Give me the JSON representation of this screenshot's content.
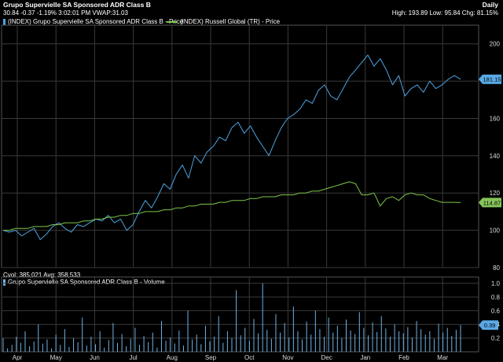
{
  "header": {
    "title": "Grupo Supervielle SA Sponsored ADR Class B",
    "quote_line": "30.84 -0.37 -1.19% 3:02:01 PM VWAP:31.03",
    "period": "Daily",
    "range_line": "High: 193.89 Low: 95.84 Chg: 81.15%"
  },
  "legend": {
    "series1": "(INDEX) Grupo Supervielle SA Sponsored ADR Class B - Price",
    "series2": "(INDEX) Russell Global (TR) - Price"
  },
  "volume_header": {
    "line1": "Cvol: 385,021 Avg: 358,533",
    "legend": "Grupo Supervielle SA Sponsored ADR Class B - Volume"
  },
  "colors": {
    "background": "#000000",
    "grid": "#3a3a3a",
    "series1": "#4da3e0",
    "series2": "#7ec64a",
    "volume": "#6fb2e6",
    "badge1": "#5aa9e6",
    "badge2": "#86c55a"
  },
  "chart_data": [
    {
      "type": "line",
      "x_labels": [
        "Apr",
        "May",
        "Jun",
        "Jul",
        "Aug",
        "Sep",
        "Oct",
        "Nov",
        "Dec",
        "Jan",
        "Feb",
        "Mar"
      ],
      "ylim": [
        80,
        210
      ],
      "y_ticks": [
        "200",
        "180",
        "160",
        "140",
        "120",
        "100",
        "80"
      ],
      "grid": true,
      "series": [
        {
          "name": "(INDEX) Grupo Supervielle SA Sponsored ADR Class B - Price",
          "last_label": "181.15",
          "values": [
            100,
            99,
            100,
            97,
            99,
            101,
            95,
            98,
            102,
            104,
            101,
            99,
            103,
            102,
            104,
            106,
            105,
            108,
            104,
            106,
            100,
            103,
            110,
            116,
            112,
            118,
            125,
            122,
            130,
            135,
            128,
            140,
            136,
            142,
            145,
            150,
            148,
            155,
            158,
            152,
            156,
            150,
            145,
            140,
            148,
            155,
            160,
            162,
            165,
            170,
            168,
            175,
            178,
            172,
            170,
            176,
            182,
            186,
            190,
            194,
            188,
            192,
            186,
            178,
            183,
            172,
            176,
            178,
            174,
            180,
            176,
            178,
            181,
            183,
            181
          ]
        },
        {
          "name": "(INDEX) Russell Global (TR) - Price",
          "last_label": "114.87",
          "values": [
            100,
            100,
            101,
            101,
            101,
            102,
            102,
            102,
            103,
            103,
            104,
            104,
            104,
            105,
            105,
            106,
            106,
            107,
            107,
            108,
            108,
            109,
            109,
            110,
            110,
            110,
            111,
            111,
            112,
            112,
            113,
            113,
            114,
            114,
            114,
            115,
            115,
            116,
            116,
            116,
            117,
            117,
            118,
            118,
            118,
            119,
            119,
            119,
            120,
            120,
            121,
            121,
            122,
            123,
            124,
            125,
            126,
            125,
            119,
            119,
            120,
            113,
            117,
            118,
            116,
            119,
            120,
            119,
            119,
            117,
            116,
            115,
            115,
            115,
            114.87
          ]
        }
      ]
    },
    {
      "type": "bar",
      "ylim": [
        0,
        1.0
      ],
      "y_ticks": [
        "1.0",
        "0.8",
        "0.6",
        "0.4",
        "0.2"
      ],
      "series": [
        {
          "name": "Grupo Supervielle SA Sponsored ADR Class B - Volume",
          "last_label": "0.39",
          "values": [
            0.2,
            0.05,
            0.1,
            0.22,
            0.13,
            0.3,
            0.08,
            0.15,
            0.4,
            0.12,
            0.18,
            0.05,
            0.25,
            0.1,
            0.33,
            0.07,
            0.2,
            0.14,
            0.5,
            0.09,
            0.22,
            0.11,
            0.3,
            0.06,
            0.17,
            0.42,
            0.13,
            0.26,
            0.08,
            0.19,
            0.35,
            0.1,
            0.23,
            0.14,
            0.28,
            0.06,
            0.45,
            0.16,
            0.21,
            0.12,
            0.31,
            0.09,
            0.6,
            0.18,
            0.25,
            0.11,
            0.38,
            0.15,
            0.22,
            0.52,
            0.13,
            0.3,
            0.2,
            0.9,
            0.24,
            0.35,
            0.16,
            0.48,
            0.27,
            1.0,
            0.32,
            0.19,
            0.55,
            0.28,
            0.42,
            0.21,
            0.66,
            0.3,
            0.18,
            0.44,
            0.25,
            0.6,
            0.33,
            0.22,
            0.5,
            0.28,
            0.38,
            0.2,
            0.47,
            0.31,
            0.26,
            0.58,
            0.35,
            0.24,
            0.43,
            0.29,
            0.52,
            0.34,
            0.22,
            0.4,
            0.3,
            0.27,
            0.36,
            0.21,
            0.45,
            0.33,
            0.25,
            0.3,
            0.19,
            0.41,
            0.28,
            0.35,
            0.23,
            0.32,
            0.39
          ]
        }
      ]
    }
  ]
}
